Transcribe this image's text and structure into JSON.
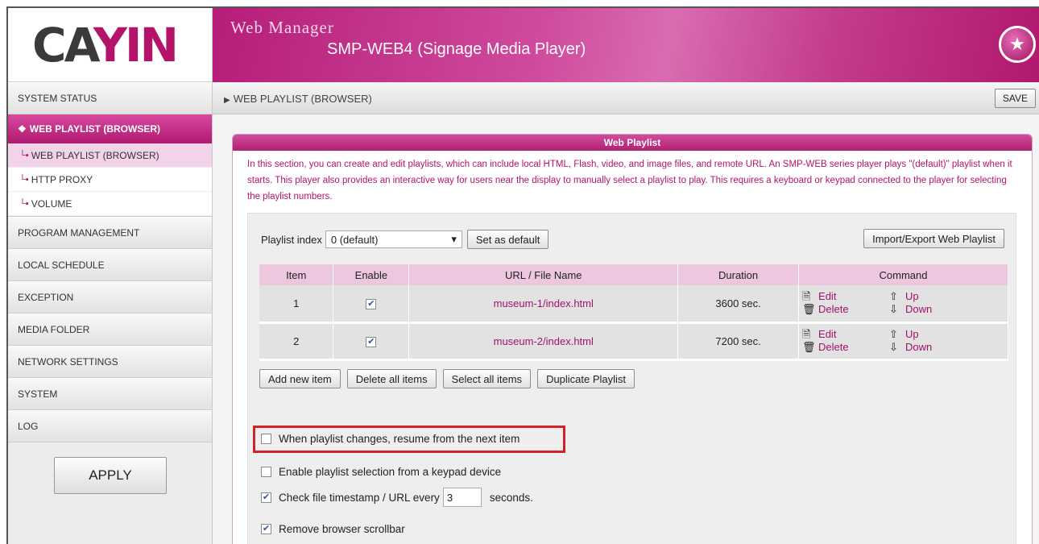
{
  "sidebar": {
    "logo_text_a": "CA",
    "logo_text_b": "YIN",
    "items": [
      {
        "label": "SYSTEM STATUS"
      },
      {
        "label": "WEB PLAYLIST (BROWSER)"
      },
      {
        "label": "PROGRAM MANAGEMENT"
      },
      {
        "label": "LOCAL SCHEDULE"
      },
      {
        "label": "EXCEPTION"
      },
      {
        "label": "MEDIA FOLDER"
      },
      {
        "label": "NETWORK SETTINGS"
      },
      {
        "label": "SYSTEM"
      },
      {
        "label": "LOG"
      }
    ],
    "sub_items": [
      {
        "label": "WEB PLAYLIST (BROWSER)"
      },
      {
        "label": "HTTP PROXY"
      },
      {
        "label": "VOLUME"
      }
    ],
    "apply_label": "APPLY"
  },
  "header": {
    "title": "Web Manager",
    "subtitle": "SMP-WEB4 (Signage Media Player)",
    "brand_color": "#b5136a"
  },
  "breadcrumb": {
    "text": "WEB PLAYLIST (BROWSER)"
  },
  "toolbar": {
    "save_label": "SAVE"
  },
  "panel": {
    "title": "Web Playlist",
    "description": "In this section, you can create and edit playlists, which can include local HTML, Flash, video, and image files, and remote URL. An SMP-WEB series player plays \"(default)\" playlist when it starts. This player also provides an interactive way for users near the display to manually select a playlist to play. This requires a keyboard or keypad connected to the player for selecting the playlist numbers."
  },
  "playlist": {
    "index_label": "Playlist index",
    "index_value": "0 (default)",
    "set_default_label": "Set as default",
    "import_export_label": "Import/Export Web Playlist",
    "columns": [
      "Item",
      "Enable",
      "URL / File Name",
      "Duration",
      "Command"
    ],
    "rows": [
      {
        "item": "1",
        "enabled": true,
        "url": "museum-1/index.html",
        "duration": "3600 sec."
      },
      {
        "item": "2",
        "enabled": true,
        "url": "museum-2/index.html",
        "duration": "7200 sec."
      }
    ],
    "cmd_edit": "Edit",
    "cmd_delete": "Delete",
    "cmd_up": "Up",
    "cmd_down": "Down",
    "buttons": {
      "add": "Add new item",
      "delete_all": "Delete all items",
      "select_all": "Select all items",
      "duplicate": "Duplicate Playlist"
    }
  },
  "options": {
    "resume_next": {
      "label": "When playlist changes, resume from the next item",
      "checked": false
    },
    "keypad": {
      "label": "Enable playlist selection from a keypad device",
      "checked": false
    },
    "timestamp": {
      "label_before": "Check file timestamp / URL every",
      "value": "3",
      "label_after": "seconds.",
      "checked": true
    },
    "scrollbar": {
      "label": "Remove browser scrollbar",
      "checked": true
    }
  }
}
